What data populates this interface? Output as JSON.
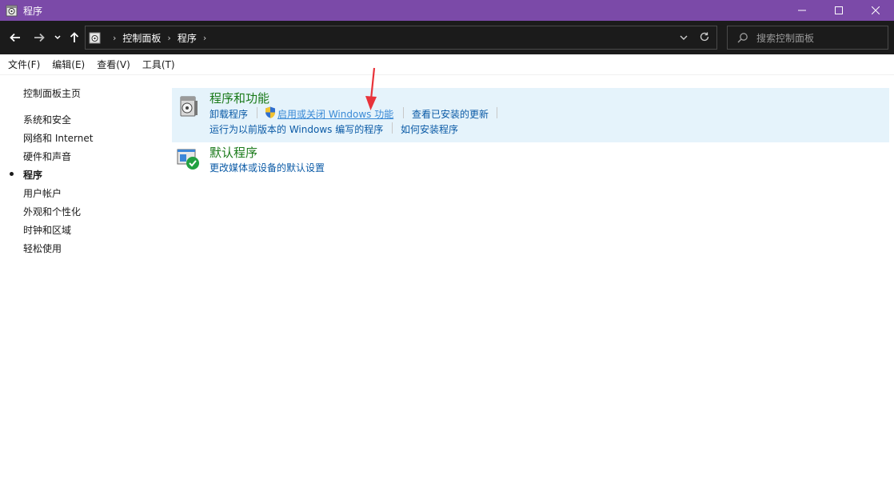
{
  "window": {
    "title": "程序",
    "minimize_icon": "minimize-icon",
    "maximize_icon": "maximize-icon",
    "close_icon": "close-icon"
  },
  "nav": {
    "breadcrumb": [
      "控制面板",
      "程序"
    ],
    "search_placeholder": "搜索控制面板"
  },
  "menu": [
    "文件(F)",
    "编辑(E)",
    "查看(V)",
    "工具(T)"
  ],
  "sidebar": {
    "home": "控制面板主页",
    "items": [
      {
        "label": "系统和安全"
      },
      {
        "label": "网络和 Internet"
      },
      {
        "label": "硬件和声音"
      },
      {
        "label": "程序",
        "current": true
      },
      {
        "label": "用户帐户"
      },
      {
        "label": "外观和个性化"
      },
      {
        "label": "时钟和区域"
      },
      {
        "label": "轻松使用"
      }
    ]
  },
  "sections": [
    {
      "title": "程序和功能",
      "links_row1": [
        "卸载程序",
        "启用或关闭 Windows 功能",
        "查看已安装的更新"
      ],
      "links_row2": [
        "运行为以前版本的 Windows 编写的程序",
        "如何安装程序"
      ]
    },
    {
      "title": "默认程序",
      "links_row1": [
        "更改媒体或设备的默认设置"
      ]
    }
  ],
  "colors": {
    "titlebar": "#7b4aa8",
    "link": "#0a5aa6",
    "section_title": "#1a7a1a",
    "highlight": "#e5f3fb",
    "annotation_arrow": "#e8333a"
  }
}
